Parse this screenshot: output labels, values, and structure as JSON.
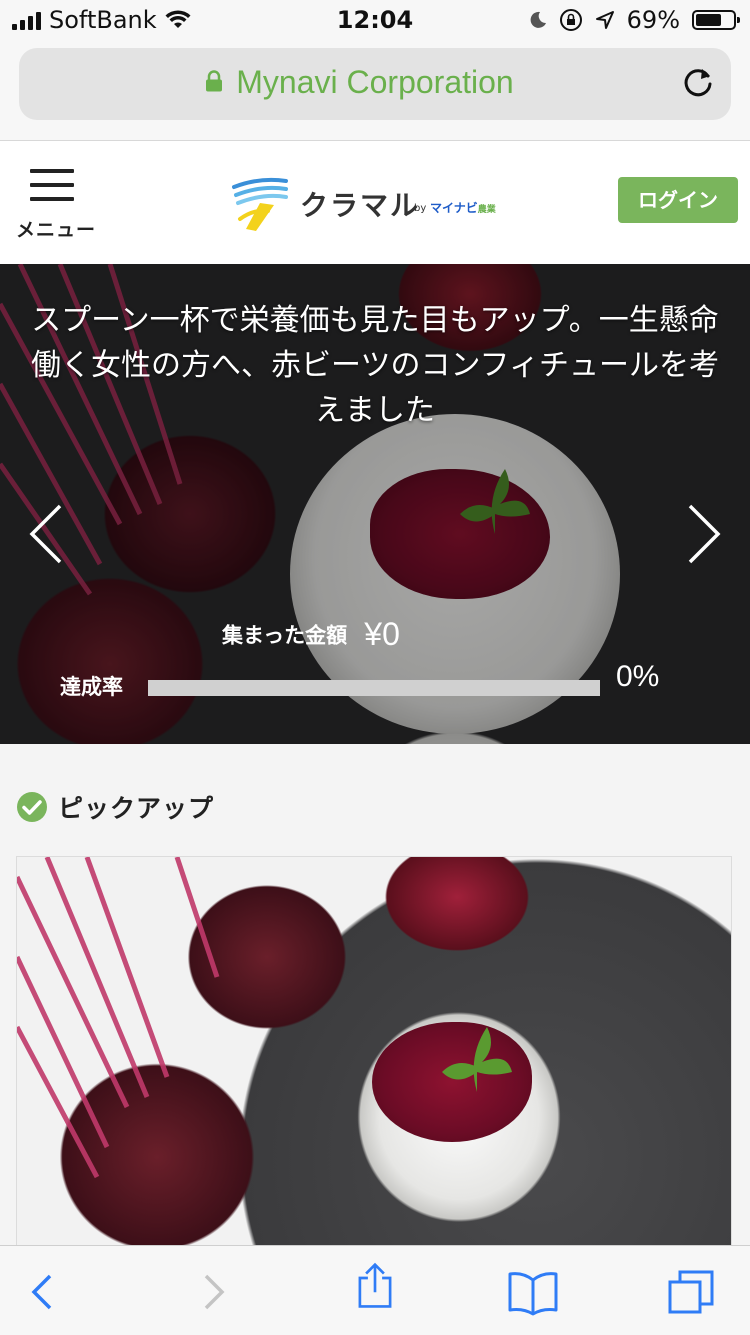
{
  "status_bar": {
    "carrier": "SoftBank",
    "time": "12:04",
    "battery": "69%",
    "battery_level": 0.69
  },
  "browser": {
    "address": "Mynavi Corporation"
  },
  "header": {
    "menu_label": "メニュー",
    "logo": {
      "name": "クラマル",
      "by": "by",
      "partner": "マイナビ",
      "partner_sub": "農業"
    },
    "login_label": "ログイン"
  },
  "hero": {
    "title": "スプーン一杯で栄養価も見た目もアップ。一生懸命働く女性の方へ、赤ビーツのコンフィチュールを考えました",
    "amount_label": "集まった金額",
    "amount_value": "¥0",
    "rate_label": "達成率",
    "rate_value": "0%",
    "rate_fraction": 0
  },
  "pickup": {
    "heading": "ピックアップ"
  },
  "colors": {
    "accent_green": "#7ab55c",
    "url_green": "#6ab04c",
    "ios_blue": "#2f7cf6"
  }
}
